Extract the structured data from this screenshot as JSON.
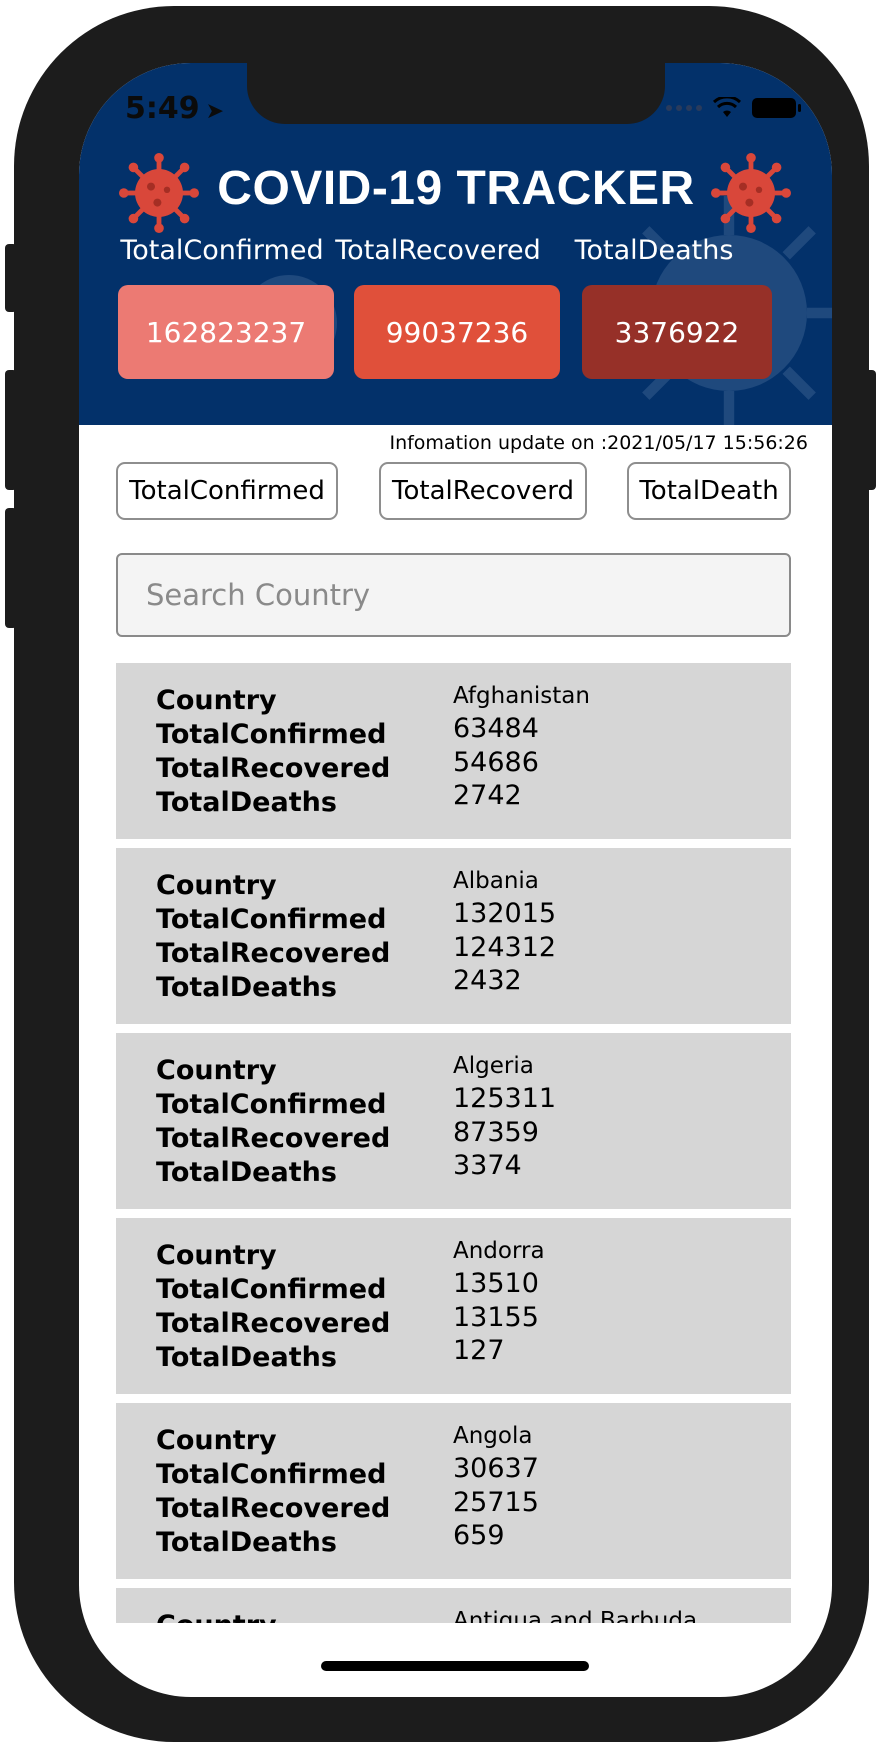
{
  "status_bar": {
    "time": "5:49",
    "location_icon": "location-arrow-icon"
  },
  "header": {
    "title": "COVID-19 TRACKER",
    "stats": [
      {
        "label": "TotalConfirmed",
        "value": "162823237",
        "color": "#ec7a73"
      },
      {
        "label": "TotalRecovered",
        "value": "99037236",
        "color": "#e0503a"
      },
      {
        "label": "TotalDeaths",
        "value": "3376922",
        "color": "#963028"
      }
    ],
    "background_color": "#03316a"
  },
  "update_info": "Infomation update on :2021/05/17 15:56:26",
  "filters": [
    "TotalConfirmed",
    "TotalRecoverd",
    "TotalDeath"
  ],
  "search": {
    "placeholder": "Search Country",
    "value": ""
  },
  "field_labels": {
    "country": "Country",
    "confirmed": "TotalConfirmed",
    "recovered": "TotalRecovered",
    "deaths": "TotalDeaths"
  },
  "countries": [
    {
      "name": "Afghanistan",
      "confirmed": "63484",
      "recovered": "54686",
      "deaths": "2742"
    },
    {
      "name": "Albania",
      "confirmed": "132015",
      "recovered": "124312",
      "deaths": "2432"
    },
    {
      "name": "Algeria",
      "confirmed": "125311",
      "recovered": "87359",
      "deaths": "3374"
    },
    {
      "name": "Andorra",
      "confirmed": "13510",
      "recovered": "13155",
      "deaths": "127"
    },
    {
      "name": "Angola",
      "confirmed": "30637",
      "recovered": "25715",
      "deaths": "659"
    },
    {
      "name": "Antigua and Barbuda",
      "confirmed": "",
      "recovered": "",
      "deaths": ""
    }
  ]
}
